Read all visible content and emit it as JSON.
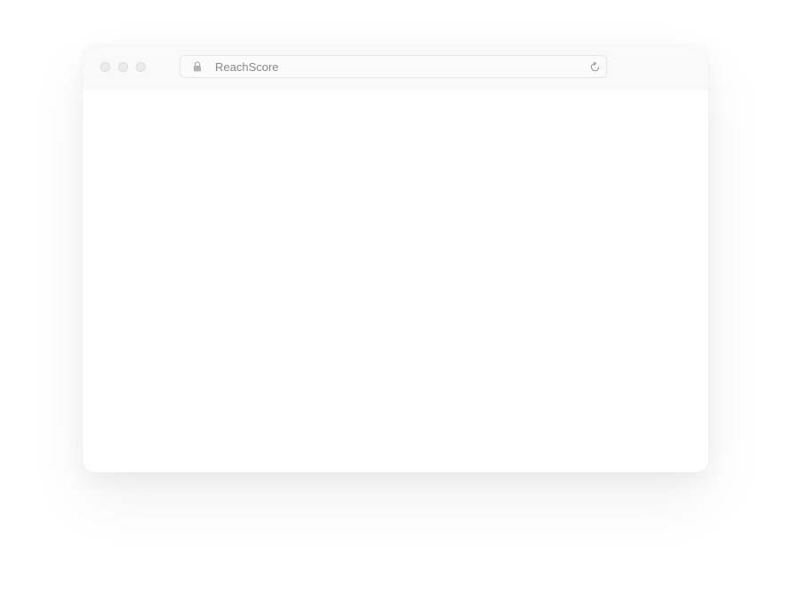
{
  "browser": {
    "address_bar": {
      "text": "ReachScore",
      "lock_icon": "lock-icon",
      "reload_icon": "reload-icon"
    },
    "traffic_lights": [
      "close",
      "minimize",
      "zoom"
    ],
    "colors": {
      "titlebar": "#f9f9f9",
      "traffic_light": "#ececec",
      "address_text": "#8a8a8a",
      "content": "#ffffff"
    }
  }
}
